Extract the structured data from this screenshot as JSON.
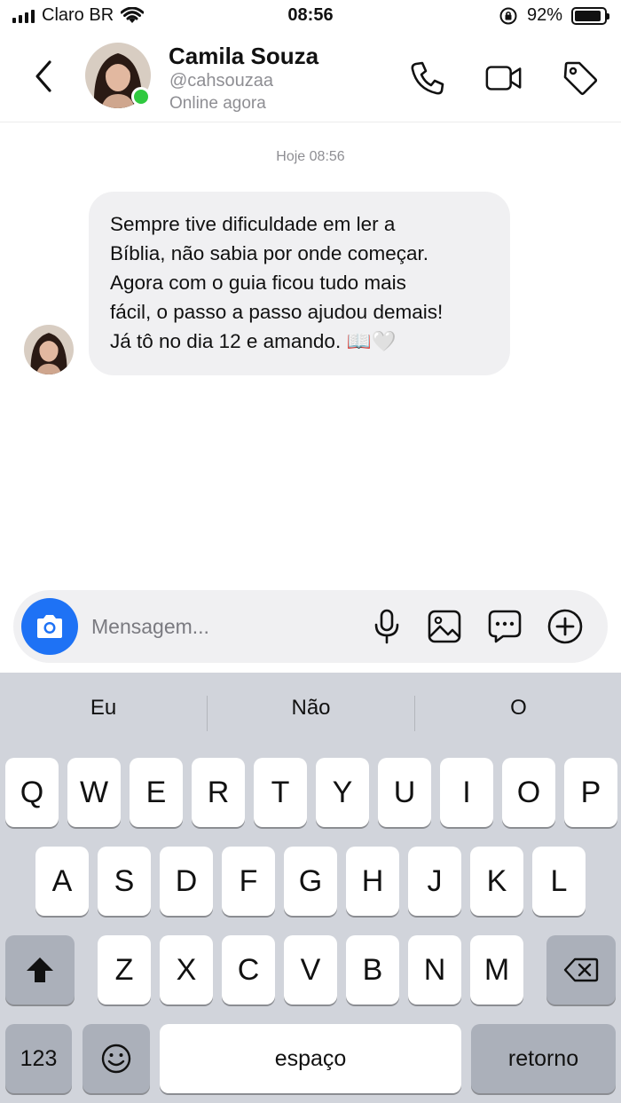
{
  "status_bar": {
    "carrier": "Claro BR",
    "time": "08:56",
    "battery_percent": "92%",
    "battery_level": 0.92
  },
  "header": {
    "name": "Camila Souza",
    "handle": "@cahsouzaa",
    "status": "Online agora",
    "icons": [
      "back-chevron-icon",
      "phone-icon",
      "video-camera-icon",
      "tag-icon"
    ],
    "online_color": "#2fc93f"
  },
  "conversation": {
    "timestamp": "Hoje 08:56",
    "message_lines": [
      "Sempre tive dificuldade em ler a",
      "Bíblia, não sabia por onde começar.",
      "Agora com o guia ficou tudo mais",
      "fácil, o passo a passo ajudou demais!",
      "Já tô no dia 12 e amando. 📖🤍"
    ]
  },
  "composer": {
    "placeholder": "Mensagem...",
    "icons": [
      "camera-icon",
      "microphone-icon",
      "image-icon",
      "sticker-chat-icon",
      "add-circle-icon"
    ],
    "camera_color": "#1e72f5"
  },
  "keyboard": {
    "suggestions": [
      "Eu",
      "Não",
      "O"
    ],
    "row1": [
      "Q",
      "W",
      "E",
      "R",
      "T",
      "Y",
      "U",
      "I",
      "O",
      "P"
    ],
    "row2": [
      "A",
      "S",
      "D",
      "F",
      "G",
      "H",
      "J",
      "K",
      "L"
    ],
    "row3": [
      "Z",
      "X",
      "C",
      "V",
      "B",
      "N",
      "M"
    ],
    "numbers_label": "123",
    "space_label": "espaço",
    "return_label": "retorno"
  }
}
